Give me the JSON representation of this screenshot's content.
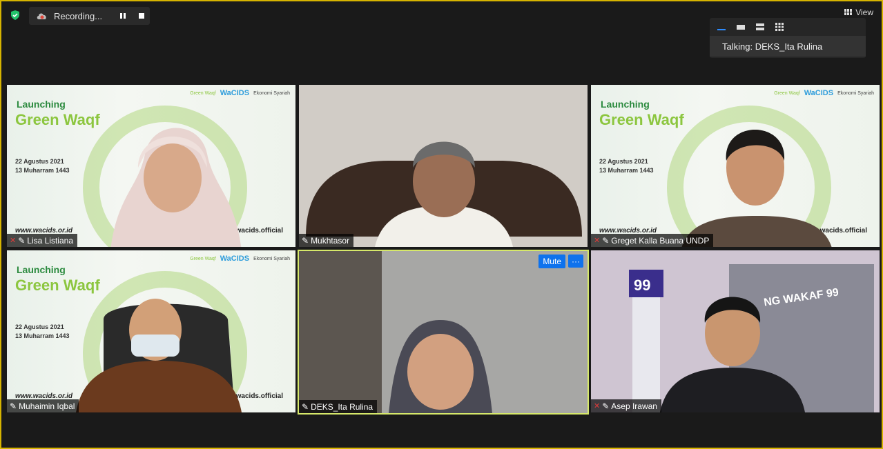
{
  "top_bar": {
    "recording_label": "Recording...",
    "view_label": "View"
  },
  "view_popup": {
    "talking_label": "Talking: DEKS_Ita Rulina"
  },
  "slide": {
    "title_line1": "Launching",
    "title_line2": "Green Waqf",
    "date_line1": "22 Agustus 2021",
    "date_line2": "13 Muharram 1443",
    "website": "www.wacids.or.id",
    "social": "wacids.official",
    "logo1": "Green Waqf",
    "logo2": "WaCIDS",
    "logo3": "Ekonomi Syariah"
  },
  "participants": [
    {
      "name": "Lisa Listiana",
      "mic_muted": true
    },
    {
      "name": "Mukhtasor",
      "mic_muted": false
    },
    {
      "name": "Greget Kalla Buana UNDP",
      "mic_muted": true
    },
    {
      "name": "Muhaimin Iqbal",
      "mic_muted": false
    },
    {
      "name": "DEKS_Ita Rulina",
      "mic_muted": false,
      "active_speaker": true
    },
    {
      "name": "Asep Irawan",
      "mic_muted": true
    }
  ],
  "tile_controls": {
    "mute_label": "Mute",
    "more_label": "···"
  },
  "background_text": {
    "building_sign": "NG WAKAF 99",
    "pole_number": "99"
  },
  "colors": {
    "active_border": "#d6e86a",
    "frame_border": "#d6b400",
    "accent": "#0e72ed"
  }
}
